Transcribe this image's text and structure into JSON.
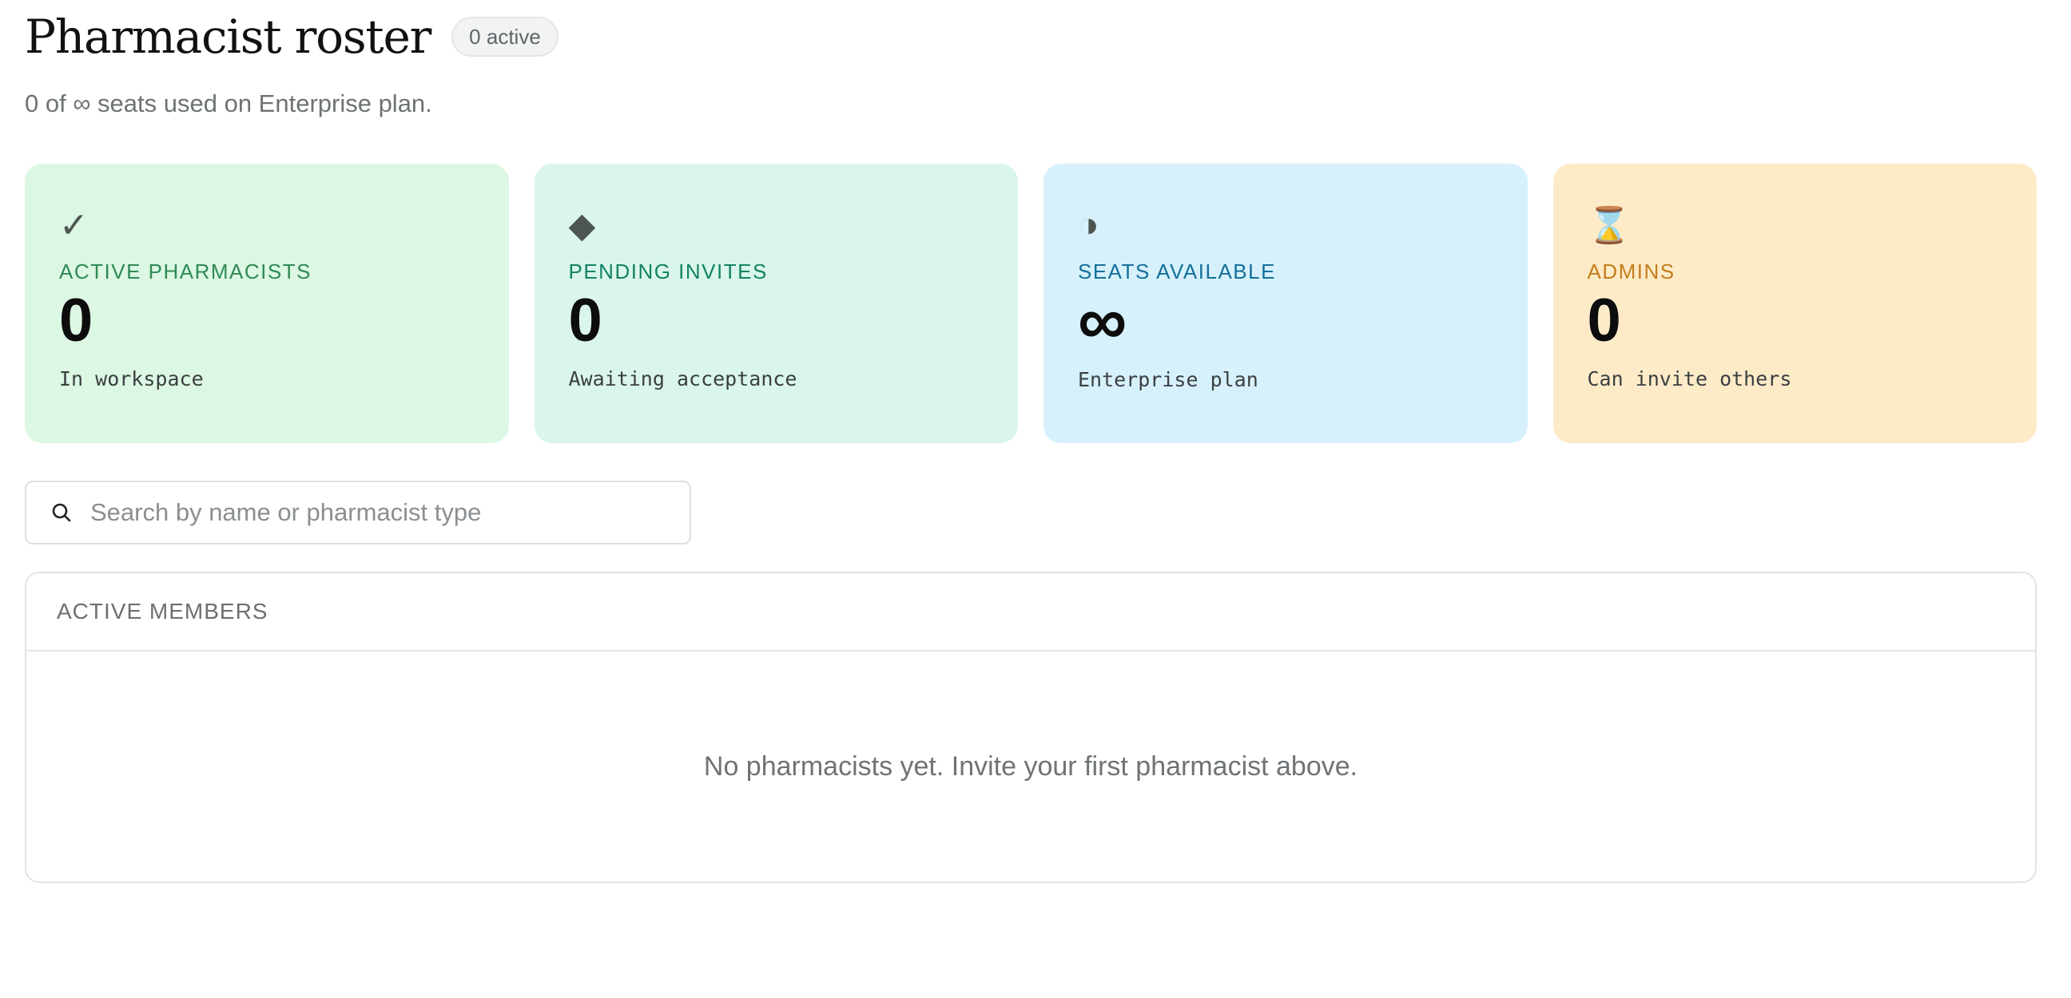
{
  "header": {
    "title": "Pharmacist roster",
    "badge": "0 active",
    "subtitle": "0 of ∞ seats used on Enterprise plan."
  },
  "stats": [
    {
      "icon": "✓",
      "icon_name": "checkmark-icon",
      "label": "ACTIVE PHARMACISTS",
      "value": "0",
      "sub": "In workspace",
      "color": "#dcf7e3"
    },
    {
      "icon": "◆",
      "icon_name": "diamond-icon",
      "label": "PENDING INVITES",
      "value": "0",
      "sub": "Awaiting acceptance",
      "color": "#daf6ea"
    },
    {
      "icon": "◑",
      "icon_name": "half-circle-icon",
      "label": "SEATS AVAILABLE",
      "value": "∞",
      "sub": "Enterprise plan",
      "color": "#d6f1fc"
    },
    {
      "icon": "⌛",
      "icon_name": "hourglass-icon",
      "label": "ADMINS",
      "value": "0",
      "sub": "Can invite others",
      "color": "#fdebc8"
    }
  ],
  "search": {
    "placeholder": "Search by name or pharmacist type",
    "value": ""
  },
  "members": {
    "heading": "ACTIVE MEMBERS",
    "empty_message": "No pharmacists yet. Invite your first pharmacist above."
  }
}
